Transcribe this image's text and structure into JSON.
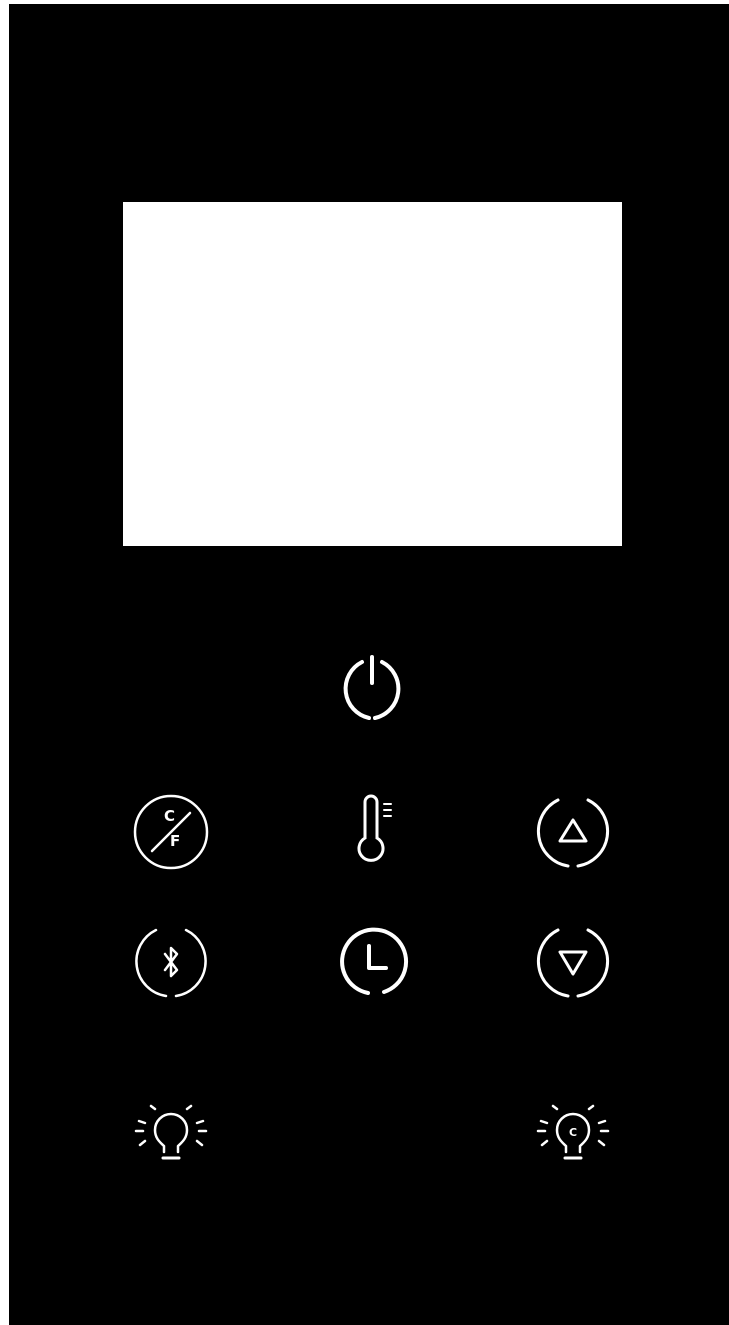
{
  "panel": {
    "background_color": "#000000",
    "icon_color": "#ffffff",
    "display_color": "#ffffff"
  },
  "buttons": [
    {
      "name": "power-button",
      "icon": "power-icon"
    },
    {
      "name": "unit-toggle-button",
      "icon": "celsius-fahrenheit-icon",
      "label_top": "C",
      "label_bottom": "F"
    },
    {
      "name": "temperature-button",
      "icon": "thermometer-icon"
    },
    {
      "name": "increase-button",
      "icon": "triangle-up-icon"
    },
    {
      "name": "bluetooth-button",
      "icon": "bluetooth-icon"
    },
    {
      "name": "timer-button",
      "icon": "clock-icon"
    },
    {
      "name": "decrease-button",
      "icon": "triangle-down-icon"
    },
    {
      "name": "light-button",
      "icon": "lightbulb-icon"
    },
    {
      "name": "color-light-button",
      "icon": "lightbulb-color-icon",
      "label": "C"
    }
  ]
}
